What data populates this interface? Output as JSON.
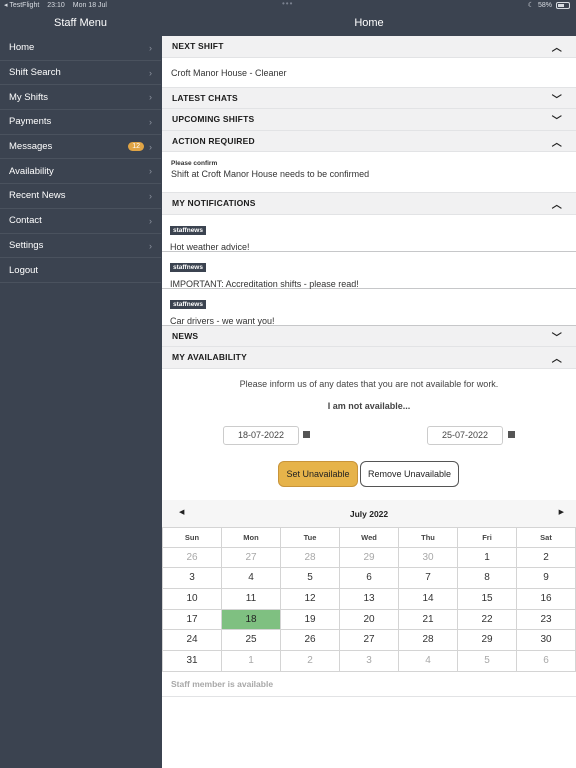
{
  "status_bar": {
    "carrier": "◂ TestFlight",
    "time": "23:10",
    "date": "Mon 18 Jul",
    "dots": "•••",
    "battery": "58%"
  },
  "sidebar": {
    "title": "Staff Menu",
    "items": [
      {
        "label": "Home"
      },
      {
        "label": "Shift Search"
      },
      {
        "label": "My Shifts"
      },
      {
        "label": "Payments"
      },
      {
        "label": "Messages",
        "badge": "12"
      },
      {
        "label": "Availability"
      },
      {
        "label": "Recent News"
      },
      {
        "label": "Contact"
      },
      {
        "label": "Settings"
      },
      {
        "label": "Logout"
      }
    ]
  },
  "main": {
    "title": "Home",
    "next_shift": {
      "header": "NEXT SHIFT",
      "value": "Croft Manor House - Cleaner",
      "expanded": true
    },
    "latest_chats": {
      "header": "LATEST CHATS",
      "expanded": false
    },
    "upcoming_shifts": {
      "header": "UPCOMING SHIFTS",
      "expanded": false
    },
    "action_required": {
      "header": "ACTION REQUIRED",
      "label": "Please confirm",
      "message": "Shift at Croft Manor House needs to be confirmed",
      "expanded": true
    },
    "notifications": {
      "header": "MY NOTIFICATIONS",
      "expanded": true,
      "items": [
        {
          "tag": "staffnews",
          "text": "Hot weather advice!"
        },
        {
          "tag": "staffnews",
          "text": "IMPORTANT: Accreditation shifts - please read!"
        },
        {
          "tag": "staffnews",
          "text": "Car drivers - we want you!"
        }
      ]
    },
    "news": {
      "header": "NEWS",
      "expanded": false
    },
    "availability": {
      "header": "MY AVAILABILITY",
      "expanded": true,
      "info": "Please inform us of any dates that you are not available for work.",
      "subtitle": "I am not available...",
      "from_date": "18-07-2022",
      "to_date": "25-07-2022",
      "set_button": "Set Unavailable",
      "remove_button": "Remove Unavailable",
      "status": "Staff member is available"
    },
    "calendar": {
      "month": "July 2022",
      "weekdays": [
        "Sun",
        "Mon",
        "Tue",
        "Wed",
        "Thu",
        "Fri",
        "Sat"
      ],
      "days": [
        [
          "26",
          "27",
          "28",
          "29",
          "30",
          "1",
          "2"
        ],
        [
          "3",
          "4",
          "5",
          "6",
          "7",
          "8",
          "9"
        ],
        [
          "10",
          "11",
          "12",
          "13",
          "14",
          "15",
          "16"
        ],
        [
          "17",
          "18",
          "19",
          "20",
          "21",
          "22",
          "23"
        ],
        [
          "24",
          "25",
          "26",
          "27",
          "28",
          "29",
          "30"
        ],
        [
          "31",
          "1",
          "2",
          "3",
          "4",
          "5",
          "6"
        ]
      ],
      "selected": "18",
      "selected_color": "#7fc081"
    }
  },
  "colors": {
    "sidebar_bg": "#3b4350",
    "accent_button": "#e6b34a",
    "badge": "#e0a445"
  }
}
